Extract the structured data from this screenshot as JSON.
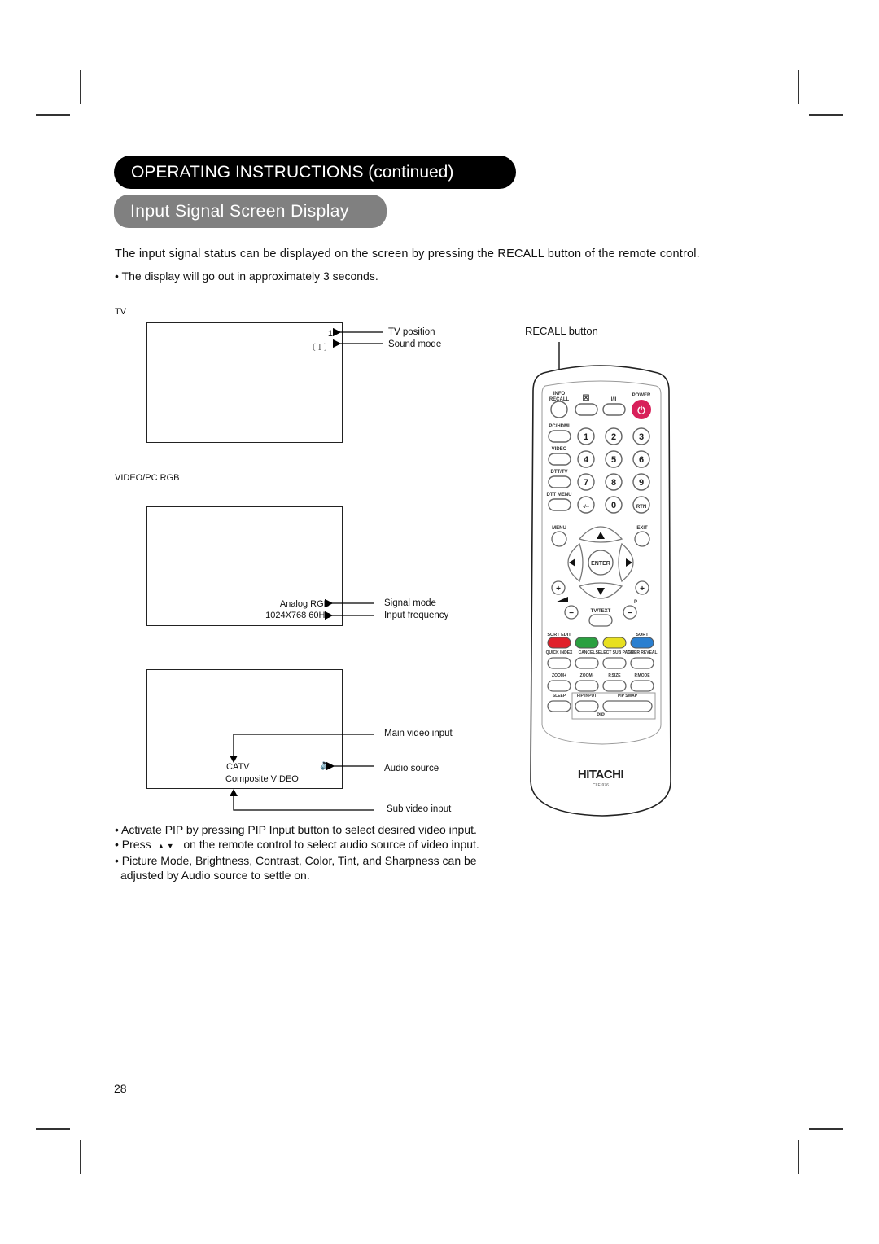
{
  "header": {
    "title": "OPERATING INSTRUCTIONS (continued)",
    "subtitle": "Input Signal Screen Display"
  },
  "intro": "The input signal status can be displayed on the screen by pressing the RECALL button of the remote control.",
  "note": "• The display will go out in approximately 3 seconds.",
  "tv_section": {
    "label": "TV",
    "screen_position": "1",
    "screen_sound": "〔 I 〕",
    "callouts": [
      "TV position",
      "Sound mode"
    ]
  },
  "pc_section": {
    "label": "VIDEO/PC RGB",
    "signal_mode": "Analog RGB",
    "frequency": "1024X768  60Hz",
    "callouts": [
      "Signal mode",
      "Input frequency"
    ]
  },
  "pip_section": {
    "main_input": "CATV",
    "sub_input": "Composite VIDEO",
    "audio_icon": "speaker-icon",
    "callouts": [
      "Main video input",
      "Audio source",
      "Sub video input"
    ]
  },
  "bullets": [
    "• Activate PIP by pressing PIP Input button to select desired video input.",
    "• Press",
    "on the remote control to select audio source of video input.",
    "• Picture Mode, Brightness, Contrast, Color, Tint, and Sharpness can be",
    "adjusted by Audio source to settle on."
  ],
  "bullet_arrows": "▲ ▼",
  "remote": {
    "recall_label": "RECALL button",
    "top_labels": [
      "INFO",
      "RECALL",
      "I/II",
      "POWER"
    ],
    "side_labels": [
      "PC/HDMI",
      "VIDEO",
      "DTT/TV",
      "DTT MENU"
    ],
    "digits": [
      "1",
      "2",
      "3",
      "4",
      "5",
      "6",
      "7",
      "8",
      "9",
      "-/--",
      "0",
      "RTN"
    ],
    "menu": "MENU",
    "exit": "EXIT",
    "enter": "ENTER",
    "p_label": "P",
    "tvtext": "TV/TEXT",
    "sort_edit": "SORT EDIT",
    "sort": "SORT",
    "colors": [
      "#e0202a",
      "#2aa040",
      "#e8e020",
      "#2a7fd0"
    ],
    "row_labels1": [
      "QUICK INDEX",
      "CANCEL",
      "SELECT SUB PAGE",
      "TIMER REVEAL"
    ],
    "row_labels2": [
      "ZOOM+",
      "ZOOM-",
      "P.SIZE",
      "P.MODE"
    ],
    "row_labels3": [
      "SLEEP",
      "PIP INPUT",
      "PIP SWAP"
    ],
    "pip": "PIP",
    "brand": "HITACHI",
    "model": "CLE-976",
    "power_color": "#d8205a"
  },
  "page_number": "28"
}
